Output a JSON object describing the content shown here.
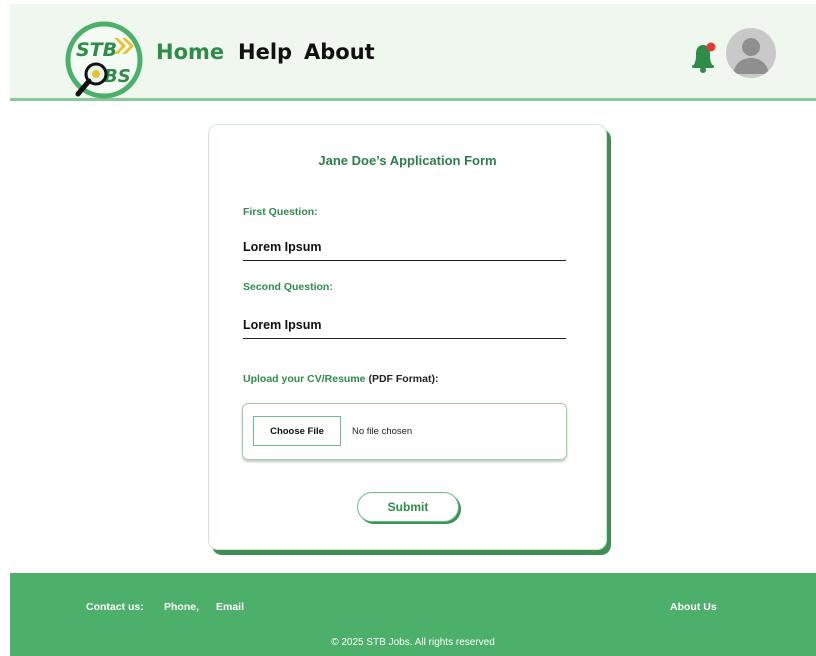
{
  "header": {
    "logo_text_top": "STB",
    "logo_text_bottom": "BS",
    "nav": {
      "home": "Home",
      "help": "Help",
      "about": "About"
    },
    "icons": {
      "notifications": "bell-icon",
      "profile": "avatar-icon"
    }
  },
  "form": {
    "title": "Jane Doe’s Application Form",
    "q1_label": "First Question:",
    "q1_value": "Lorem Ipsum",
    "q2_label": "Second Question:",
    "q2_value": "Lorem Ipsum",
    "upload_label_a": "Upload your  CV/Resume",
    "upload_label_b": " (PDF Format):",
    "choose_file": "Choose File",
    "no_file": "No file chosen",
    "submit": "Submit"
  },
  "footer": {
    "contact": "Contact us:",
    "phone": "Phone,",
    "email": "Email",
    "about": "About Us",
    "copyright": "© 2025 STB Jobs. All rights reserved"
  },
  "colors": {
    "brand_green": "#4caf6a",
    "text_green": "#2e8b4a",
    "notification_dot": "#e53935"
  }
}
